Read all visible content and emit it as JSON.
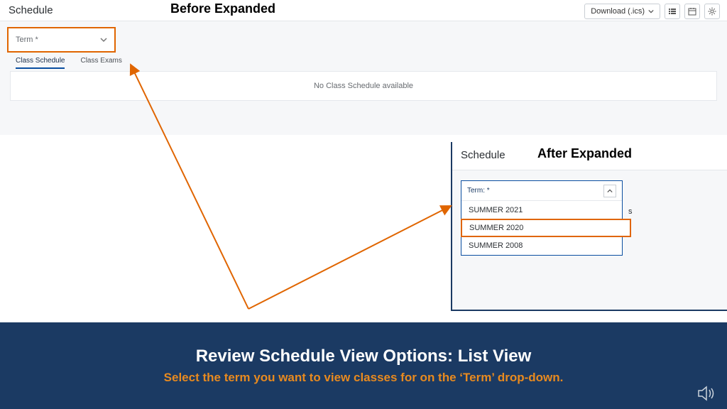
{
  "annotation": {
    "before_label": "Before Expanded",
    "after_label": "After Expanded"
  },
  "schedule": {
    "title": "Schedule",
    "toolbar": {
      "download_label": "Download (.ics)"
    },
    "term_select": {
      "label_collapsed": "Term *",
      "label_expanded": "Term: *",
      "options": [
        "SUMMER 2021",
        "SUMMER 2020",
        "SUMMER 2008"
      ],
      "highlighted_index": 1
    },
    "tabs": {
      "class_schedule": "Class Schedule",
      "class_exams": "Class Exams"
    },
    "empty_message": "No Class Schedule available"
  },
  "footer": {
    "title": "Review Schedule View Options: List View",
    "subtitle": "Select the term you want to view classes for on the ‘Term’ drop-down."
  },
  "colors": {
    "highlight": "#e06500",
    "footer_bg": "#1b3a63",
    "footer_accent": "#e88a1f",
    "link_blue": "#0a4ea0"
  }
}
